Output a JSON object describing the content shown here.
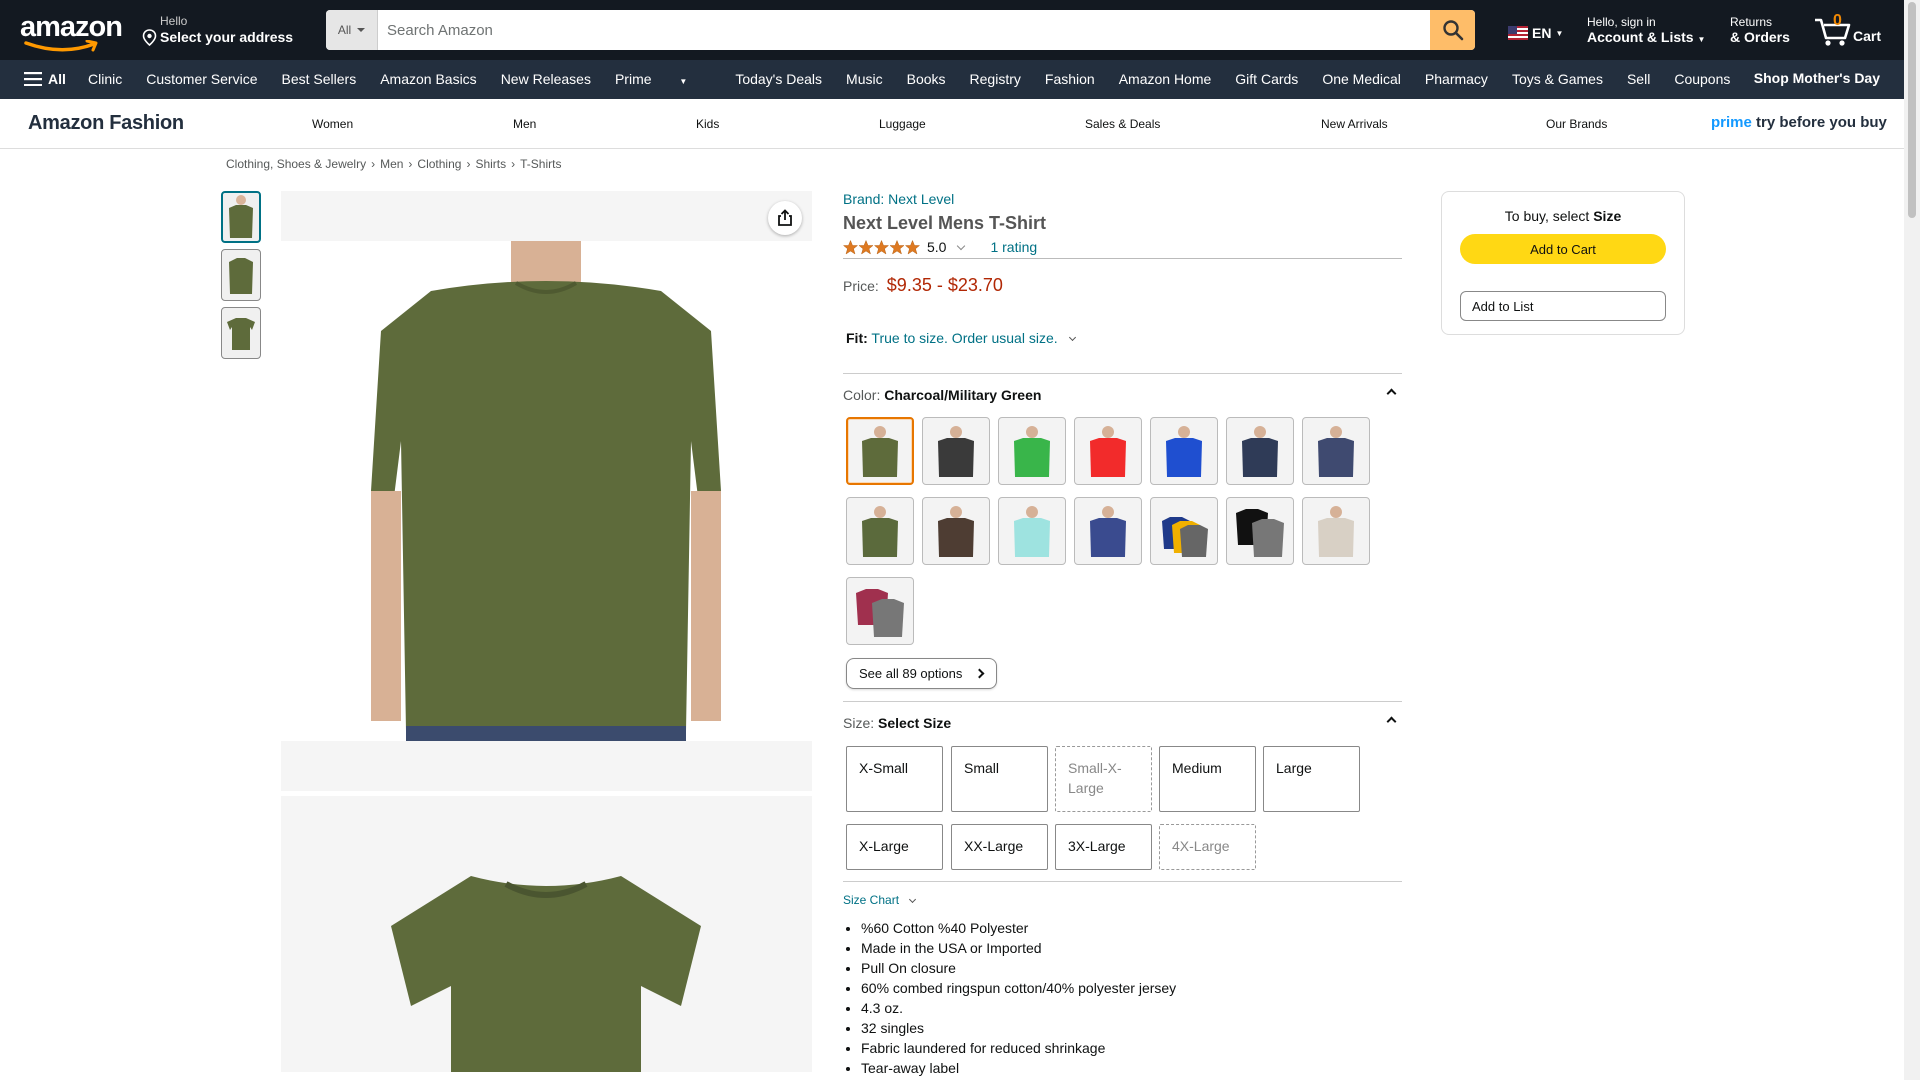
{
  "header": {
    "logo": "amazon",
    "location": {
      "line1": "Hello",
      "line2": "Select your address"
    },
    "search": {
      "category": "All",
      "placeholder": "Search Amazon",
      "value": ""
    },
    "language": "EN",
    "account": {
      "line1": "Hello, sign in",
      "line2": "Account & Lists"
    },
    "returns": {
      "line1": "Returns",
      "line2": "& Orders"
    },
    "cart": {
      "count": "0",
      "label": "Cart"
    }
  },
  "subnav": {
    "all_label": "All",
    "items": [
      "Clinic",
      "Customer Service",
      "Best Sellers",
      "Amazon Basics",
      "New Releases",
      "Prime",
      "Today's Deals",
      "Music",
      "Books",
      "Registry",
      "Fashion",
      "Amazon Home",
      "Gift Cards",
      "One Medical",
      "Pharmacy",
      "Toys & Games",
      "Sell",
      "Coupons"
    ],
    "promo": "Shop Mother's Day"
  },
  "fashion_bar": {
    "brand": "Amazon Fashion",
    "categories": [
      "Women",
      "Men",
      "Kids",
      "Luggage",
      "Sales & Deals",
      "New Arrivals",
      "Our Brands"
    ],
    "prime_word": "prime",
    "prime_tagline": "try before you buy"
  },
  "breadcrumb": [
    "Clothing, Shoes & Jewelry",
    "Men",
    "Clothing",
    "Shirts",
    "T-Shirts"
  ],
  "product": {
    "brand": "Brand: Next Level",
    "title": "Next Level Mens T-Shirt",
    "rating_value": "5.0",
    "rating_count": "1 rating",
    "price_label": "Price:",
    "price": "$9.35 - $23.70",
    "fit_label": "Fit:",
    "fit_value": "True to size. Order usual size.",
    "color_label": "Color:",
    "color_selected": "Charcoal/Military Green",
    "colors": [
      "#5e6b3b",
      "#3a3a3a",
      "#39b54a",
      "#f22b2b",
      "#1f4fd0",
      "#2f3b57",
      "#3f4a70",
      "#5b6a3c",
      "#4e3d33",
      "#9ee3e0",
      "#3a4b8f",
      "multi-pack",
      "black-grey",
      "#d8d0c5",
      "maroon-grey"
    ],
    "see_all": "See all 89 options",
    "size_label": "Size:",
    "size_selected": "Select Size",
    "sizes": [
      {
        "label": "X-Small",
        "available": true
      },
      {
        "label": "Small",
        "available": true
      },
      {
        "label": "Small-X-Large",
        "available": false
      },
      {
        "label": "Medium",
        "available": true
      },
      {
        "label": "Large",
        "available": true
      },
      {
        "label": "X-Large",
        "available": true
      },
      {
        "label": "XX-Large",
        "available": true
      },
      {
        "label": "3X-Large",
        "available": true
      },
      {
        "label": "4X-Large",
        "available": false
      }
    ],
    "size_chart": "Size Chart",
    "bullets": [
      "%60 Cotton %40 Polyester",
      "Made in the USA or Imported",
      "Pull On closure",
      "60% combed ringspun cotton/40% polyester jersey",
      "4.3 oz.",
      "32 singles",
      "Fabric laundered for reduced shrinkage",
      "Tear-away label"
    ]
  },
  "buybox": {
    "hint_prefix": "To buy, select ",
    "hint_bold": "Size",
    "add_to_cart": "Add to Cart",
    "add_to_list": "Add to List"
  },
  "colors": {
    "nav_dark": "#131921",
    "nav_sub": "#232f3e",
    "search_button": "#febd69",
    "price": "#b12704",
    "link": "#007185",
    "cart_button": "#ffd814",
    "selected_swatch": "#e77600"
  }
}
